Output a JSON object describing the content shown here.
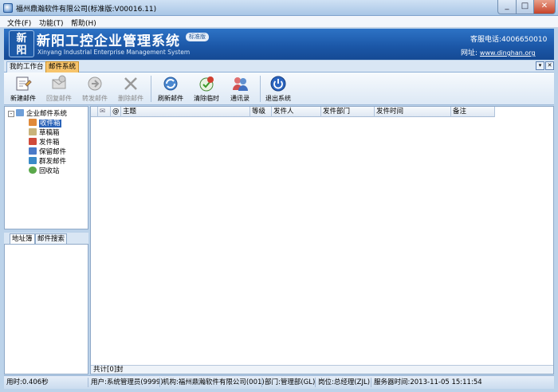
{
  "window": {
    "title": "福州鼎瀚软件有限公司(标准版:V00016.11)",
    "min": "_",
    "max": "□",
    "close": "✕"
  },
  "menubar": [
    "文件(F)",
    "功能(T)",
    "帮助(H)"
  ],
  "banner": {
    "logo_top": "新",
    "logo_bottom": "阳",
    "brand": "新阳工控企业管理系统",
    "edition": "标准版",
    "subtitle": "Xinyang Industrial Enterprise Management System",
    "phone": "客服电话:4006650010",
    "site_label": "网址:",
    "site_url": "www.dinghan.org"
  },
  "tabs": [
    "我的工作台",
    "邮件系统"
  ],
  "tab_controls": {
    "restore": "▾",
    "close": "✕"
  },
  "toolbar": [
    {
      "label": "新建邮件",
      "icon": "new-mail-icon",
      "enabled": true
    },
    {
      "label": "回复邮件",
      "icon": "reply-mail-icon",
      "enabled": false
    },
    {
      "label": "转发邮件",
      "icon": "forward-mail-icon",
      "enabled": false
    },
    {
      "label": "删除邮件",
      "icon": "delete-mail-icon",
      "enabled": false
    },
    {
      "label": "刷新邮件",
      "icon": "refresh-icon",
      "enabled": true
    },
    {
      "label": "清除临时",
      "icon": "clear-temp-icon",
      "enabled": true
    },
    {
      "label": "通讯录",
      "icon": "contacts-icon",
      "enabled": true
    },
    {
      "label": "退出系统",
      "icon": "power-icon",
      "enabled": true
    }
  ],
  "tree": {
    "root": "企业邮件系统",
    "items": [
      "收件箱",
      "草稿箱",
      "发件箱",
      "保留邮件",
      "群发邮件",
      "回收站"
    ],
    "selected": "收件箱"
  },
  "left_tabs": [
    "地址簿",
    "邮件搜索"
  ],
  "grid": {
    "columns": [
      "✉",
      "@",
      "主题",
      "等级",
      "发件人",
      "发件部门",
      "发件时间",
      "备注"
    ],
    "rows": [],
    "footer": "共计[0]封"
  },
  "status": {
    "elapsed": "用时:0.406秒",
    "user": "用户:系统管理员(9999)",
    "org": "机构:福州鼎瀚软件有限公司(001)",
    "dept": "部门:管理部(GL)",
    "post": "岗位:总经理(ZJL)",
    "server_time": "服务器时间:2013-11-05 15:11:54"
  },
  "colors": {
    "banner": "#1b56a6",
    "active_tab": "#f7c46b",
    "selection": "#2a63b8"
  }
}
